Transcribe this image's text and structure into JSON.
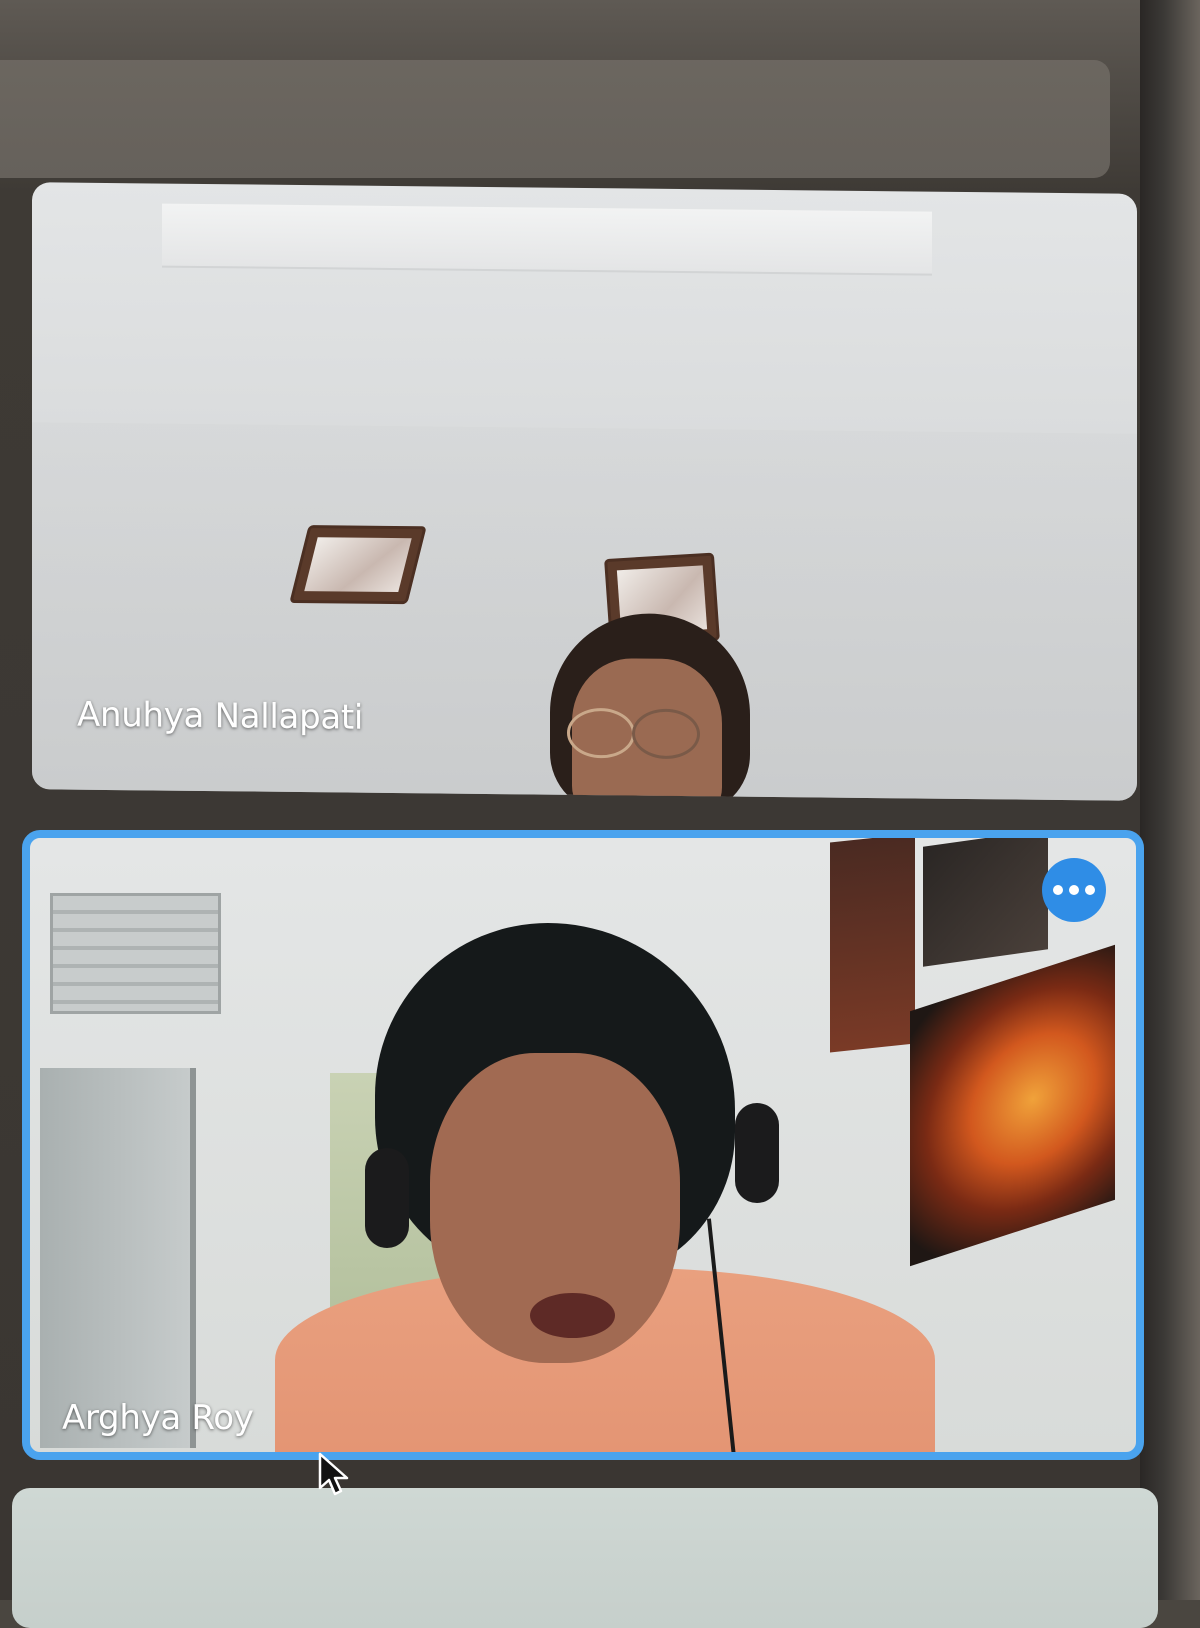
{
  "meeting": {
    "participants": [
      {
        "name": "Anuhya Nallapati",
        "active_speaker": false
      },
      {
        "name": "Arghya Roy",
        "active_speaker": true
      }
    ],
    "more_options_icon": "ellipsis-icon"
  },
  "colors": {
    "active_border": "#4aa3ee",
    "more_button": "#2f8de6",
    "label_text": "#ffffff"
  }
}
